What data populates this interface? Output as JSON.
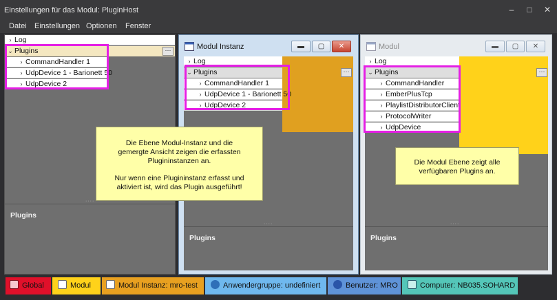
{
  "window": {
    "title": "Einstellungen für das Modul: PluginHost",
    "controls": {
      "minimize": "–",
      "maximize": "□",
      "close": "✕"
    }
  },
  "menu": [
    "Datei",
    "Einstellungen",
    "Optionen",
    "Fenster"
  ],
  "left_panel": {
    "log": "Log",
    "plugins": "Plugins",
    "items": [
      "CommandHandler 1",
      "UdpDevice 1 - Barionett 50",
      "UdpDevice 2"
    ],
    "plugins_footer": "Plugins"
  },
  "modul_instanz": {
    "title": "Modul Instanz",
    "log": "Log",
    "plugins": "Plugins",
    "items": [
      "CommandHandler 1",
      "UdpDevice 1 - Barionett 50",
      "UdpDevice 2"
    ],
    "plugins_footer": "Plugins",
    "highlight_color": "#e0a020"
  },
  "modul": {
    "title": "Modul",
    "log": "Log",
    "plugins": "Plugins",
    "items": [
      "CommandHandler",
      "EmberPlusTcp",
      "PlaylistDistributorClient",
      "ProtocolWriter",
      "UdpDevice"
    ],
    "plugins_footer": "Plugins",
    "highlight_color": "#ffd21a"
  },
  "callouts": {
    "instanz_line1": "Die Ebene Modul-Instanz und die",
    "instanz_line2": "gemergte Ansicht zeigen die erfassten",
    "instanz_line3": "Plugininstanzen an.",
    "instanz_line4": "Nur wenn eine Plugininstanz erfasst und",
    "instanz_line5": "aktiviert ist, wird das Plugin ausgeführt!",
    "modul_line1": "Die Modul Ebene zeigt alle",
    "modul_line2": "verfügbaren Plugins an."
  },
  "statusbar": {
    "global": "Global",
    "modul": "Modul",
    "instanz": "Modul Instanz: mro-test",
    "anwendergruppe": "Anwendergruppe: undefiniert",
    "benutzer": "Benutzer: MRO",
    "computer": "Computer: NB035.SOHARD"
  },
  "colors": {
    "global": "#e0102a",
    "modul": "#ffd21a",
    "instanz": "#e8a020",
    "anwendergruppe": "#6fb8ee",
    "benutzer": "#5f93d8",
    "computer": "#54c6b8",
    "magenta": "#e51fe5"
  }
}
